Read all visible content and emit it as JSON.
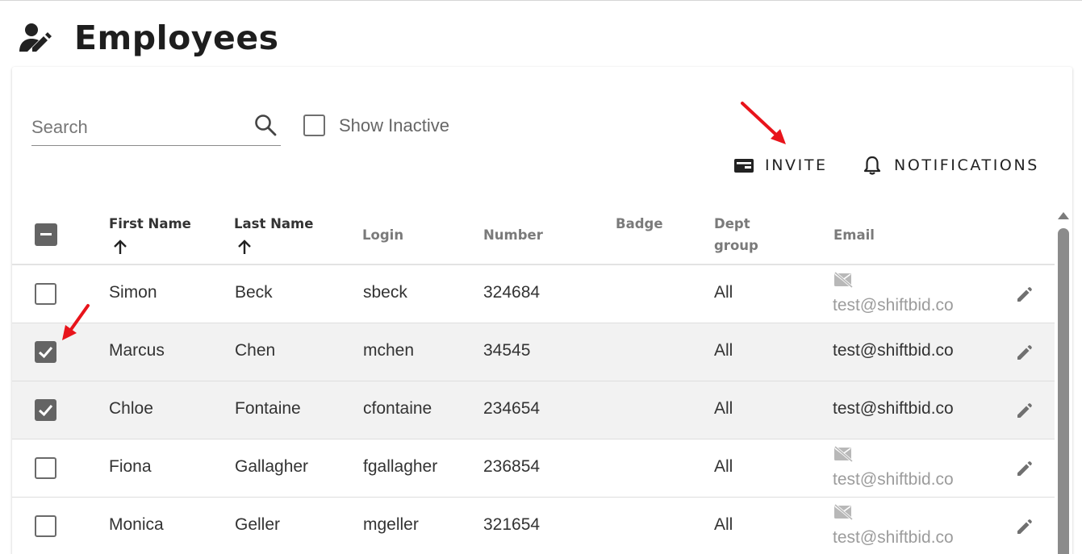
{
  "header": {
    "title": "Employees",
    "icon": "person-edit-icon"
  },
  "toolbar": {
    "search_placeholder": "Search",
    "show_inactive_label": "Show Inactive",
    "show_inactive_checked": false,
    "invite_label": "INVITE",
    "notifications_label": "NOTIFICATIONS"
  },
  "table": {
    "columns": {
      "first_name": "First Name",
      "last_name": "Last Name",
      "login": "Login",
      "number": "Number",
      "badge": "Badge",
      "dept_group_1": "Dept",
      "dept_group_2": "group",
      "email": "Email"
    },
    "sorted_columns": [
      "First Name",
      "Last Name"
    ],
    "select_all_state": "indeterminate",
    "rows": [
      {
        "first": "Simon",
        "last": "Beck",
        "login": "sbeck",
        "number": "324684",
        "badge": "",
        "dept": "All",
        "email": "test@shiftbid.co",
        "email_disabled": true,
        "checked": false
      },
      {
        "first": "Marcus",
        "last": "Chen",
        "login": "mchen",
        "number": "34545",
        "badge": "",
        "dept": "All",
        "email": "test@shiftbid.co",
        "email_disabled": false,
        "checked": true
      },
      {
        "first": "Chloe",
        "last": "Fontaine",
        "login": "cfontaine",
        "number": "234654",
        "badge": "",
        "dept": "All",
        "email": "test@shiftbid.co",
        "email_disabled": false,
        "checked": true
      },
      {
        "first": "Fiona",
        "last": "Gallagher",
        "login": "fgallagher",
        "number": "236854",
        "badge": "",
        "dept": "All",
        "email": "test@shiftbid.co",
        "email_disabled": true,
        "checked": false
      },
      {
        "first": "Monica",
        "last": "Geller",
        "login": "mgeller",
        "number": "321654",
        "badge": "",
        "dept": "All",
        "email": "test@shiftbid.co",
        "email_disabled": true,
        "checked": false
      }
    ]
  },
  "annotation_color": "#e8141b"
}
